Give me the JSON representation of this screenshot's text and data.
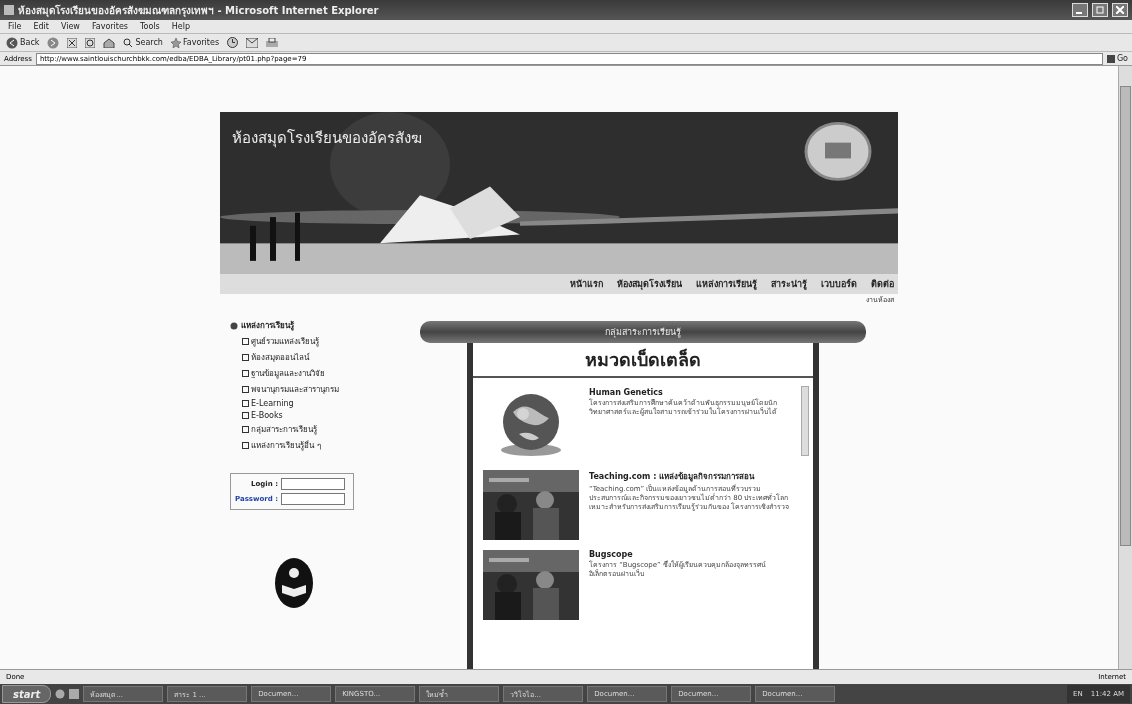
{
  "window": {
    "title": "ห้องสมุดโรงเรียนของอัครสังฆมณฑลกรุงเทพฯ - Microsoft Internet Explorer"
  },
  "menu": [
    "File",
    "Edit",
    "View",
    "Favorites",
    "Tools",
    "Help"
  ],
  "toolbar": {
    "back": "Back",
    "search": "Search",
    "favorites": "Favorites"
  },
  "address": {
    "label": "Address",
    "value": "http://www.saintlouischurchbkk.com/edba/EDBA_Library/pt01.php?page=79",
    "go": "Go"
  },
  "banner": {
    "title": "ห้องสมุดโรงเรียนของอัครสังฆ"
  },
  "nav": [
    "หน้าแรก",
    "ห้องสมุดโรงเรียน",
    "แหล่งการเรียนรู้",
    "สาระน่ารู้",
    "เวบบอร์ด",
    "ติดต่อ"
  ],
  "breadcrumb": "งานห้องส",
  "sidebar": {
    "heading": "แหล่งการเรียนรู้",
    "items": [
      "ศูนย์รวมแหล่งเรียนรู้",
      "ห้องสมุดออนไลน์",
      "ฐานข้อมูลและงานวิจัย",
      "พจนานุกรมและสารานุกรม",
      "E-Learning",
      "E-Books",
      "กลุ่มสาระการเรียนรู้",
      "แหล่งการเรียนรู้อื่น ๆ"
    ]
  },
  "login": {
    "login_label": "Login :",
    "password_label": "Password :"
  },
  "scroll_banner": "กลุ่มสาระการเรียนรู้",
  "section": {
    "heading": "หมวดเบ็ดเตล็ด",
    "items": [
      {
        "title": "Human Genetics",
        "text": "โครงการส่งเสริมการศึกษาค้นคว้าด้านพันธุกรรมมนุษย์โดยนักวิทยาศาสตร์และผู้สนใจสามารถเข้าร่วมในโครงการผ่านเว็บได้",
        "kind": "picture"
      },
      {
        "title": "Teaching.com : แหล่งข้อมูลกิจกรรมการสอน",
        "text": "“Teaching.com” เป็นแหล่งข้อมูลด้านการสอนที่รวบรวมประสบการณ์และกิจกรรมของเยาวชนไม่ต่ำกว่า 80 ประเทศทั่วโลก เหมาะสำหรับการส่งเสริมการเรียนรู้ร่วมกันของ โครงการเชิงสำรวจ",
        "kind": "picture"
      },
      {
        "title": "Bugscope",
        "text": "โครงการ “Bugscope” ซึ่งให้ผู้เรียนควบคุมกล้องจุลทรรศน์อิเล็กตรอนผ่านเว็บ",
        "kind": "picture"
      }
    ]
  },
  "status_bar": {
    "text": "Done",
    "zone": "Internet"
  },
  "taskbar": {
    "start": "start",
    "items": [
      "ห้องสมุด...",
      "สาระ 1 ...",
      "Documen...",
      "KINGSTO...",
      "ใหม่ซ้ำ",
      "ววิโจไอ...",
      "Documen...",
      "Documen...",
      "Documen..."
    ],
    "language": "EN",
    "clock": "11:42 AM"
  }
}
